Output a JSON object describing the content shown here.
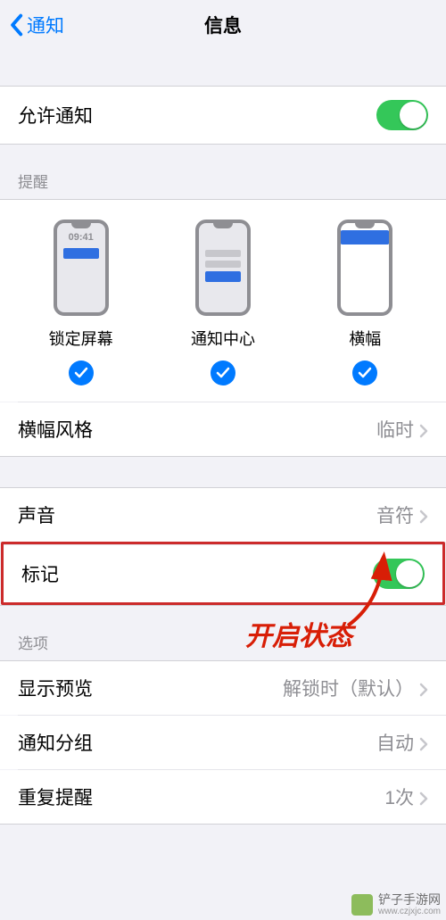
{
  "header": {
    "back_label": "通知",
    "title": "信息"
  },
  "allow_notifications": {
    "label": "允许通知"
  },
  "alerts": {
    "section_title": "提醒",
    "lock_screen": {
      "label": "锁定屏幕",
      "time": "09:41"
    },
    "notification_center": {
      "label": "通知中心"
    },
    "banners": {
      "label": "横幅"
    }
  },
  "banner_style": {
    "label": "横幅风格",
    "value": "临时"
  },
  "sounds": {
    "label": "声音",
    "value": "音符"
  },
  "badges": {
    "label": "标记"
  },
  "options": {
    "section_title": "选项",
    "show_previews": {
      "label": "显示预览",
      "value": "解锁时（默认）"
    },
    "notification_grouping": {
      "label": "通知分组",
      "value": "自动"
    },
    "repeat_alerts": {
      "label": "重复提醒",
      "value": "1次"
    }
  },
  "annotation": {
    "text": "开启状态"
  },
  "watermark": {
    "name": "铲子手游网",
    "url": "www.czjxjc.com"
  }
}
